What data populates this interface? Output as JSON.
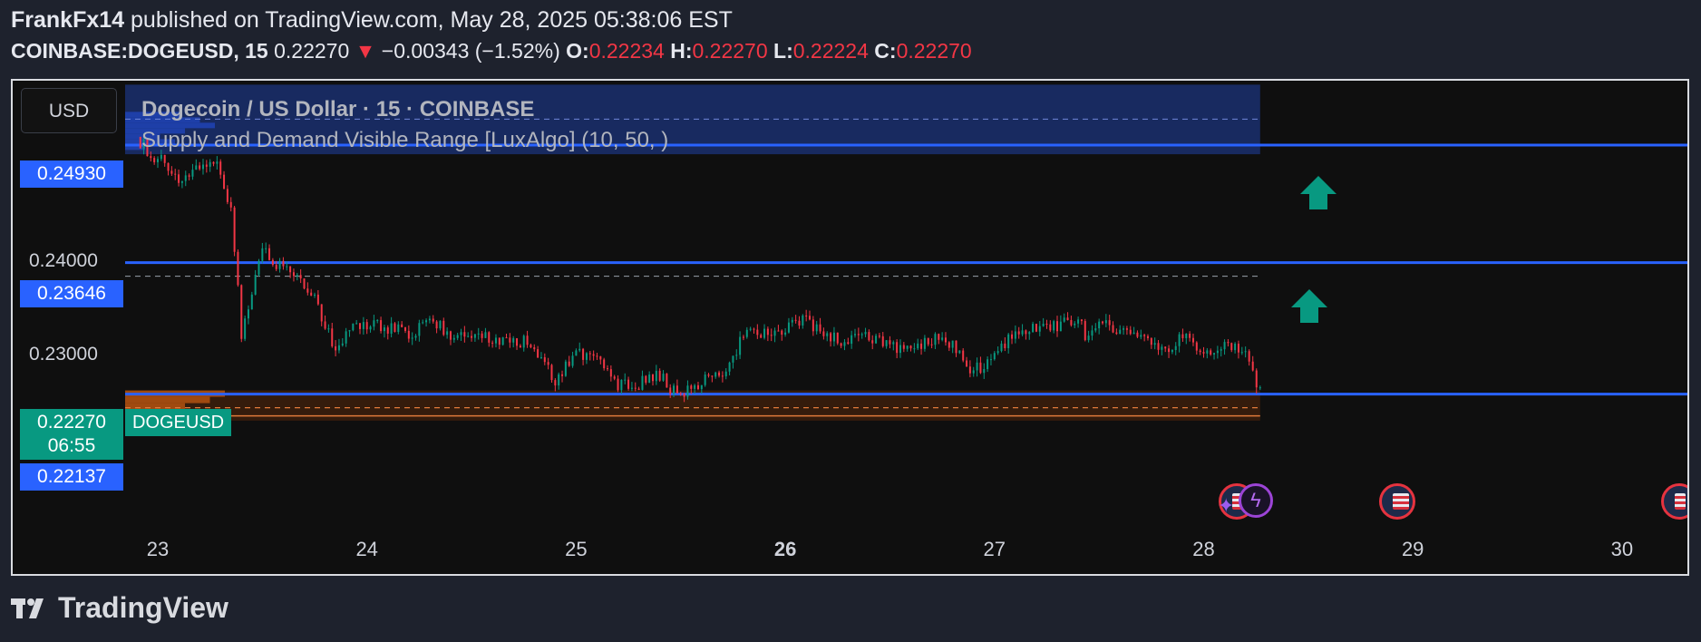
{
  "header": {
    "author": "FrankFx14",
    "published": "published on TradingView.com, May 28, 2025 05:38:06 EST",
    "symbol": "COINBASE:DOGEUSD, 15",
    "last": "0.22270",
    "change": "−0.00343 (−1.52%)",
    "o_label": "O:",
    "o": "0.22234",
    "h_label": "H:",
    "h": "0.22270",
    "l_label": "L:",
    "l": "0.22224",
    "c_label": "C:",
    "c": "0.22270"
  },
  "currency_button": "USD",
  "chart_title": "Dogecoin / US Dollar · 15 · COINBASE",
  "indicator_title": "Supply and Demand Visible Range [LuxAlgo] (10, 50, )",
  "price_labels": {
    "resistance1": "0.24930",
    "tick1": "0.24000",
    "resistance2": "0.23646",
    "tick2": "0.23000",
    "last_price": "0.22270",
    "countdown": "06:55",
    "symbol_tag": "DOGEUSD",
    "support": "0.22137"
  },
  "footer_brand": "TradingView",
  "colors": {
    "up": "#089981",
    "down": "#f23645",
    "level_line": "#2962ff",
    "supply_zone": "#1a2f6e",
    "demand_zone": "#3a1e0c",
    "last_price_bg": "#089981"
  },
  "icons": [
    "arrow-up-icon",
    "arrow-up-icon",
    "lightning-icon",
    "us-flag-icon",
    "us-flag-icon",
    "us-flag-icon"
  ],
  "chart_data": {
    "type": "candlestick",
    "x_ticks": [
      "23",
      "24",
      "25",
      "26",
      "27",
      "28",
      "29",
      "30"
    ],
    "y_ticks": [
      0.24,
      0.23
    ],
    "ylim": [
      0.2195,
      0.254
    ],
    "levels": [
      0.2493,
      0.23646,
      0.22137
    ],
    "last_price": 0.2227,
    "supply_zone": [
      0.2483,
      0.2559
    ],
    "demand_zone": [
      0.2192,
      0.2225
    ],
    "price_path": [
      [
        22.9,
        0.2502
      ],
      [
        22.95,
        0.2488
      ],
      [
        23.0,
        0.2478
      ],
      [
        23.05,
        0.2468
      ],
      [
        23.1,
        0.2448
      ],
      [
        23.15,
        0.2458
      ],
      [
        23.2,
        0.247
      ],
      [
        23.25,
        0.2478
      ],
      [
        23.3,
        0.2462
      ],
      [
        23.35,
        0.2425
      ],
      [
        23.4,
        0.2288
      ],
      [
        23.45,
        0.2335
      ],
      [
        23.5,
        0.2378
      ],
      [
        23.55,
        0.2362
      ],
      [
        23.6,
        0.2365
      ],
      [
        23.65,
        0.2352
      ],
      [
        23.7,
        0.234
      ],
      [
        23.75,
        0.2322
      ],
      [
        23.8,
        0.23
      ],
      [
        23.85,
        0.2268
      ],
      [
        23.9,
        0.2288
      ],
      [
        23.95,
        0.2296
      ],
      [
        24.0,
        0.2298
      ],
      [
        24.1,
        0.2294
      ],
      [
        24.2,
        0.2286
      ],
      [
        24.3,
        0.2299
      ],
      [
        24.4,
        0.2288
      ],
      [
        24.5,
        0.229
      ],
      [
        24.6,
        0.2282
      ],
      [
        24.7,
        0.2282
      ],
      [
        24.8,
        0.2272
      ],
      [
        24.9,
        0.2238
      ],
      [
        25.0,
        0.2268
      ],
      [
        25.1,
        0.2261
      ],
      [
        25.2,
        0.223
      ],
      [
        25.3,
        0.2232
      ],
      [
        25.4,
        0.2242
      ],
      [
        25.5,
        0.2215
      ],
      [
        25.6,
        0.2238
      ],
      [
        25.7,
        0.2242
      ],
      [
        25.8,
        0.2285
      ],
      [
        25.9,
        0.229
      ],
      [
        26.0,
        0.2294
      ],
      [
        26.1,
        0.23
      ],
      [
        26.2,
        0.2282
      ],
      [
        26.3,
        0.2278
      ],
      [
        26.4,
        0.2286
      ],
      [
        26.5,
        0.2272
      ],
      [
        26.6,
        0.227
      ],
      [
        26.7,
        0.2282
      ],
      [
        26.8,
        0.2278
      ],
      [
        26.9,
        0.2244
      ],
      [
        27.0,
        0.2268
      ],
      [
        27.1,
        0.229
      ],
      [
        27.2,
        0.2292
      ],
      [
        27.3,
        0.2296
      ],
      [
        27.4,
        0.2303
      ],
      [
        27.45,
        0.228
      ],
      [
        27.5,
        0.2296
      ],
      [
        27.6,
        0.2291
      ],
      [
        27.7,
        0.2279
      ],
      [
        27.8,
        0.2271
      ],
      [
        27.9,
        0.2283
      ],
      [
        28.0,
        0.227
      ],
      [
        28.1,
        0.2276
      ],
      [
        28.2,
        0.2264
      ],
      [
        28.27,
        0.2227
      ]
    ]
  }
}
